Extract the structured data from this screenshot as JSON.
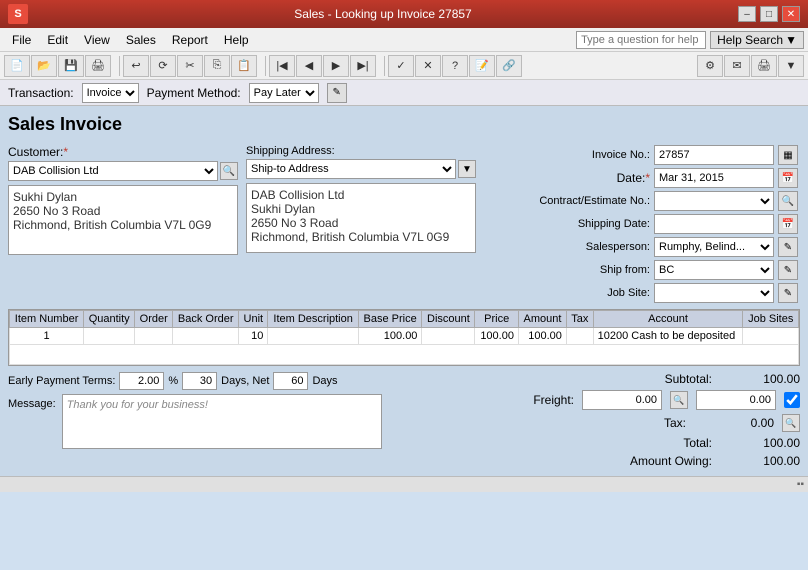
{
  "window": {
    "title": "Sales - Looking up Invoice 27857",
    "logo": "S"
  },
  "window_controls": {
    "minimize": "–",
    "maximize": "□",
    "close": "✕"
  },
  "menu": {
    "items": [
      "File",
      "Edit",
      "View",
      "Sales",
      "Report",
      "Help"
    ]
  },
  "help_search": {
    "placeholder": "Type a question for help",
    "button_label": "Help Search",
    "dropdown_arrow": "▼"
  },
  "transaction_bar": {
    "transaction_label": "Transaction:",
    "transaction_value": "Invoice",
    "payment_method_label": "Payment Method:",
    "payment_method_value": "Pay Later"
  },
  "invoice": {
    "title": "Sales Invoice",
    "invoice_no_label": "Invoice No.:",
    "invoice_no_value": "27857",
    "date_label": "Date:",
    "date_value": "Mar 31, 2015",
    "contract_label": "Contract/Estimate No.:",
    "contract_value": "",
    "shipping_date_label": "Shipping Date:",
    "shipping_date_value": "",
    "salesperson_label": "Salesperson:",
    "salesperson_value": "Rumphy, Belind...",
    "ship_from_label": "Ship from:",
    "ship_from_value": "BC",
    "job_site_label": "Job Site:",
    "job_site_value": ""
  },
  "customer": {
    "label": "Customer:",
    "required": true,
    "value": "DAB Collision Ltd",
    "address_lines": [
      "Sukhi Dylan",
      "2650 No 3 Road",
      "Richmond, British Columbia  V7L 0G9"
    ]
  },
  "shipping": {
    "label": "Shipping Address:",
    "value": "Ship-to Address",
    "address_lines": [
      "DAB Collision Ltd",
      "Sukhi Dylan",
      "2650 No 3 Road",
      "Richmond, British Columbia  V7L 0G9"
    ]
  },
  "table": {
    "headers": [
      "Item Number",
      "Quantity",
      "Order",
      "Back Order",
      "Unit",
      "Item Description",
      "Base Price",
      "Discount",
      "Price",
      "Amount",
      "Tax",
      "Account",
      "Job Sites"
    ],
    "rows": [
      {
        "item_number": "1",
        "quantity": "",
        "order": "",
        "back_order": "",
        "unit": "10",
        "description": "",
        "base_price": "100.00",
        "discount": "",
        "price": "100.00",
        "amount": "100.00",
        "tax": "",
        "account": "10200 Cash to be deposited",
        "job_sites": ""
      }
    ]
  },
  "totals": {
    "subtotal_label": "Subtotal:",
    "subtotal_value": "100.00",
    "freight_label": "Freight:",
    "freight_value": "0.00",
    "freight_extra": "0.00",
    "tax_label": "Tax:",
    "tax_value": "0.00",
    "total_label": "Total:",
    "total_value": "100.00",
    "amount_owing_label": "Amount Owing:",
    "amount_owing_value": "100.00"
  },
  "early_payment": {
    "label": "Early Payment Terms:",
    "percent": "2.00",
    "percent_symbol": "%",
    "days1": "30",
    "days_net_label": "Days, Net",
    "days2": "60",
    "days_label": "Days"
  },
  "message": {
    "label": "Message:",
    "value": "Thank you for your business!"
  },
  "status_bar": {
    "text": "▪▪"
  }
}
